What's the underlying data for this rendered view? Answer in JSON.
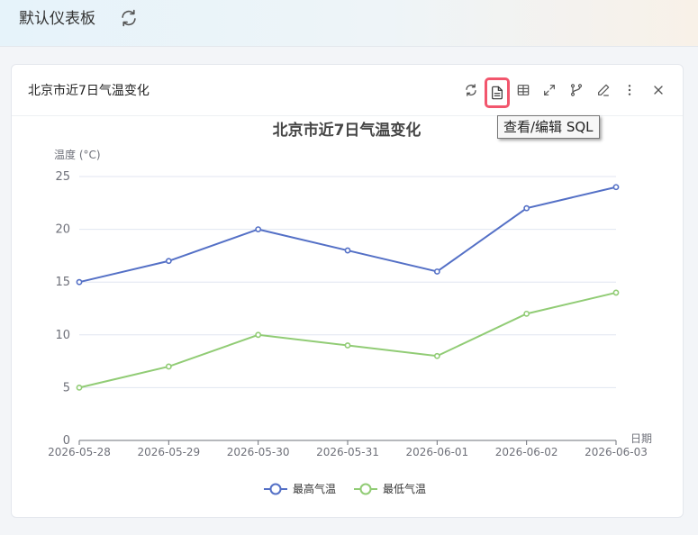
{
  "dashboard": {
    "title": "默认仪表板"
  },
  "widget": {
    "title": "北京市近7日气温变化",
    "tooltip": "查看/编辑 SQL",
    "toolbar": [
      "refresh-icon",
      "sql-file-icon",
      "table-icon",
      "expand-icon",
      "branch-icon",
      "edit-icon",
      "more-icon",
      "close-icon"
    ]
  },
  "colors": {
    "high": "#5470c6",
    "low": "#91cc75",
    "highlight": "#f2566d"
  },
  "chart_data": {
    "type": "line",
    "title": "北京市近7日气温变化",
    "xlabel": "日期",
    "ylabel": "温度 (°C)",
    "categories": [
      "2026-05-28",
      "2026-05-29",
      "2026-05-30",
      "2026-05-31",
      "2026-06-01",
      "2026-06-02",
      "2026-06-03"
    ],
    "series": [
      {
        "name": "最高气温",
        "values": [
          15,
          17,
          20,
          18,
          16,
          22,
          24
        ]
      },
      {
        "name": "最低气温",
        "values": [
          5,
          7,
          10,
          9,
          8,
          12,
          14
        ]
      }
    ],
    "ylim": [
      0,
      25
    ],
    "yticks": [
      "0",
      "5",
      "10",
      "15",
      "20",
      "25"
    ],
    "grid": true,
    "legend": "bottom-center"
  }
}
